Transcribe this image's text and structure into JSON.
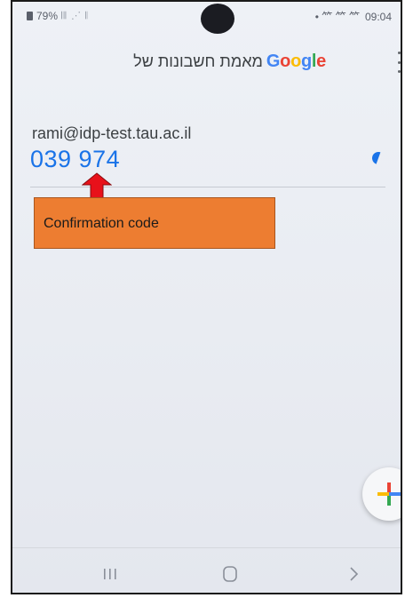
{
  "status_bar": {
    "battery_text": "79%",
    "signal_text": "𝄃𝄃 ⋰ 𝄃",
    "right_icons": "• ⺮ ⺮ ⺮",
    "time": "09:04"
  },
  "app_bar": {
    "title_hebrew": "מאמת חשבונות של",
    "google_letters": [
      "G",
      "o",
      "o",
      "g",
      "l",
      "e"
    ]
  },
  "account": {
    "email": "rami@idp-test.tau.ac.il",
    "code": "039 974"
  },
  "annotation": {
    "label": "Confirmation code"
  },
  "colors": {
    "code_blue": "#1a73e8",
    "annotation_orange": "#ed7d31",
    "arrow_red": "#e8111a"
  },
  "icons": {
    "more": "more-vert-icon",
    "timer": "timer-icon",
    "add": "plus-icon",
    "recent": "recent-apps-icon",
    "home": "home-icon",
    "back": "back-icon"
  }
}
